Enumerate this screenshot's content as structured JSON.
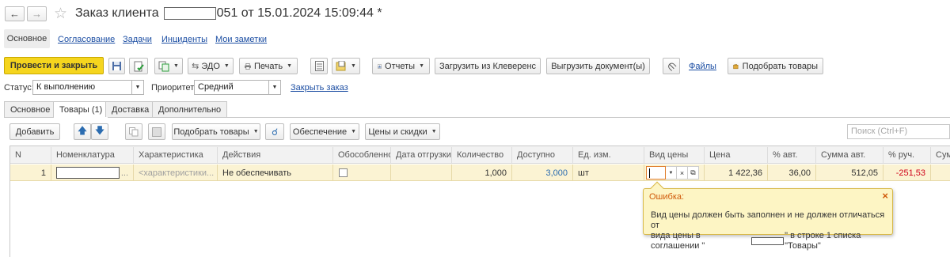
{
  "window": {
    "title_prefix": "Заказ клиента",
    "title_suffix": "051 от 15.01.2024 15:09:44 *",
    "back_icon": "arrow-left-icon",
    "forward_icon": "arrow-right-icon",
    "favorite_icon": "star-icon"
  },
  "sections": {
    "main": "Основное",
    "links": [
      "Согласование",
      "Задачи",
      "Инциденты",
      "Мои заметки"
    ]
  },
  "toolbar": {
    "post_close": "Провести и закрыть",
    "edo": "ЭДО",
    "print": "Печать",
    "reports": "Отчеты",
    "load_cleverence": "Загрузить из Клеверенс",
    "unload_document": "Выгрузить документ(ы)",
    "files": "Файлы",
    "pick_goods": "Подобрать товары"
  },
  "status_row": {
    "status_label": "Статус:",
    "status_value": "К выполнению",
    "priority_label": "Приоритет:",
    "priority_value": "Средний",
    "close_order": "Закрыть заказ"
  },
  "tabs": [
    "Основное",
    "Товары (1)",
    "Доставка",
    "Дополнительно"
  ],
  "goods_toolbar": {
    "add": "Добавить",
    "pick_goods": "Подобрать товары",
    "provision": "Обеспечение",
    "prices_discounts": "Цены и скидки",
    "search_placeholder": "Поиск (Ctrl+F)"
  },
  "table": {
    "headers": [
      "N",
      "Номенклатура",
      "Характеристика",
      "Действия",
      "Обособленно",
      "Дата отгрузки",
      "Количество",
      "Доступно",
      "Ед. изм.",
      "Вид цены",
      "Цена",
      "% авт.",
      "Сумма авт.",
      "% руч.",
      "Сум"
    ],
    "row": {
      "n": "1",
      "nomenclature_suffix": "...",
      "characteristic": "<характеристики...",
      "action": "Не обеспечивать",
      "separately": false,
      "ship_date": "",
      "quantity": "1,000",
      "available": "3,000",
      "unit": "шт",
      "price_type": "",
      "price": "1 422,36",
      "auto_percent": "36,00",
      "auto_sum": "512,05",
      "manual_percent": "-251,53"
    }
  },
  "error_tooltip": {
    "title": "Ошибка:",
    "line1": "Вид цены должен быть заполнен и не должен отличаться от",
    "line2_prefix": "вида цены в соглашении \"",
    "line2_suffix": "\" в строке 1 списка \"Товары\""
  },
  "colors": {
    "primary_button": "#f5d51e",
    "link": "#1c4ea3",
    "row_highlight": "#fbf3d3",
    "tooltip_bg": "#fdf5c4",
    "negative": "#d0021b",
    "available": "#2b6cb0"
  }
}
